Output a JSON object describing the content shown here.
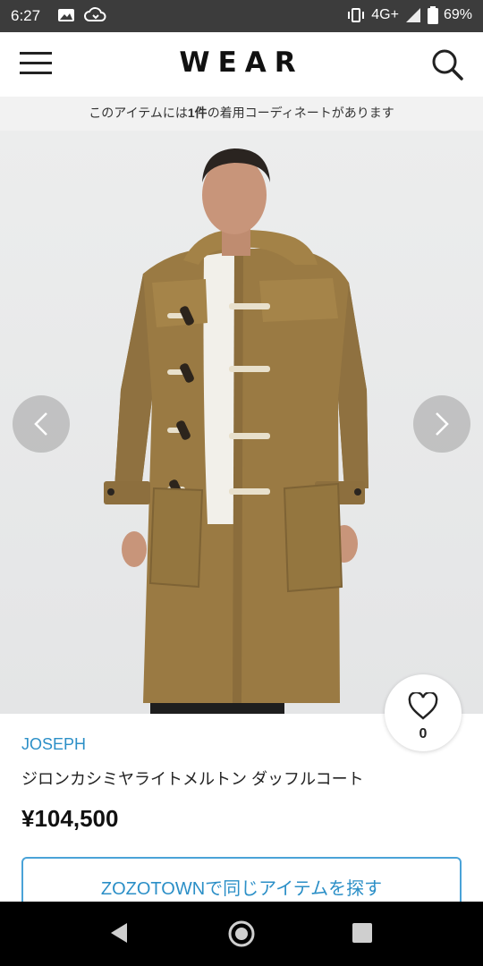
{
  "status_bar": {
    "time": "6:27",
    "network": "4G+",
    "battery": "69%",
    "icons": [
      "image-icon",
      "cloud-icon",
      "vibrate-icon",
      "signal-icon",
      "battery-icon"
    ]
  },
  "header": {
    "logo": "WEAR",
    "menu_icon": "hamburger-menu-icon",
    "search_icon": "search-icon"
  },
  "banner": {
    "prefix": "このアイテムには",
    "count": "1件",
    "suffix": "の着用コーディネートがあります"
  },
  "carousel": {
    "prev_icon": "chevron-left-icon",
    "next_icon": "chevron-right-icon"
  },
  "favorite": {
    "icon": "heart-icon",
    "count": "0"
  },
  "product": {
    "brand": "JOSEPH",
    "name": "ジロンカシミヤライトメルトン ダッフルコート",
    "price": "¥104,500"
  },
  "zozo_button": {
    "label": "ZOZOTOWNで同じアイテムを探す"
  },
  "nav_bar": {
    "icons": [
      "back-icon",
      "home-icon",
      "recent-apps-icon"
    ]
  },
  "colors": {
    "accent_blue": "#2b8fc7",
    "coat_camel": "#9a7a43",
    "status_bar": "#3c3c3c"
  }
}
